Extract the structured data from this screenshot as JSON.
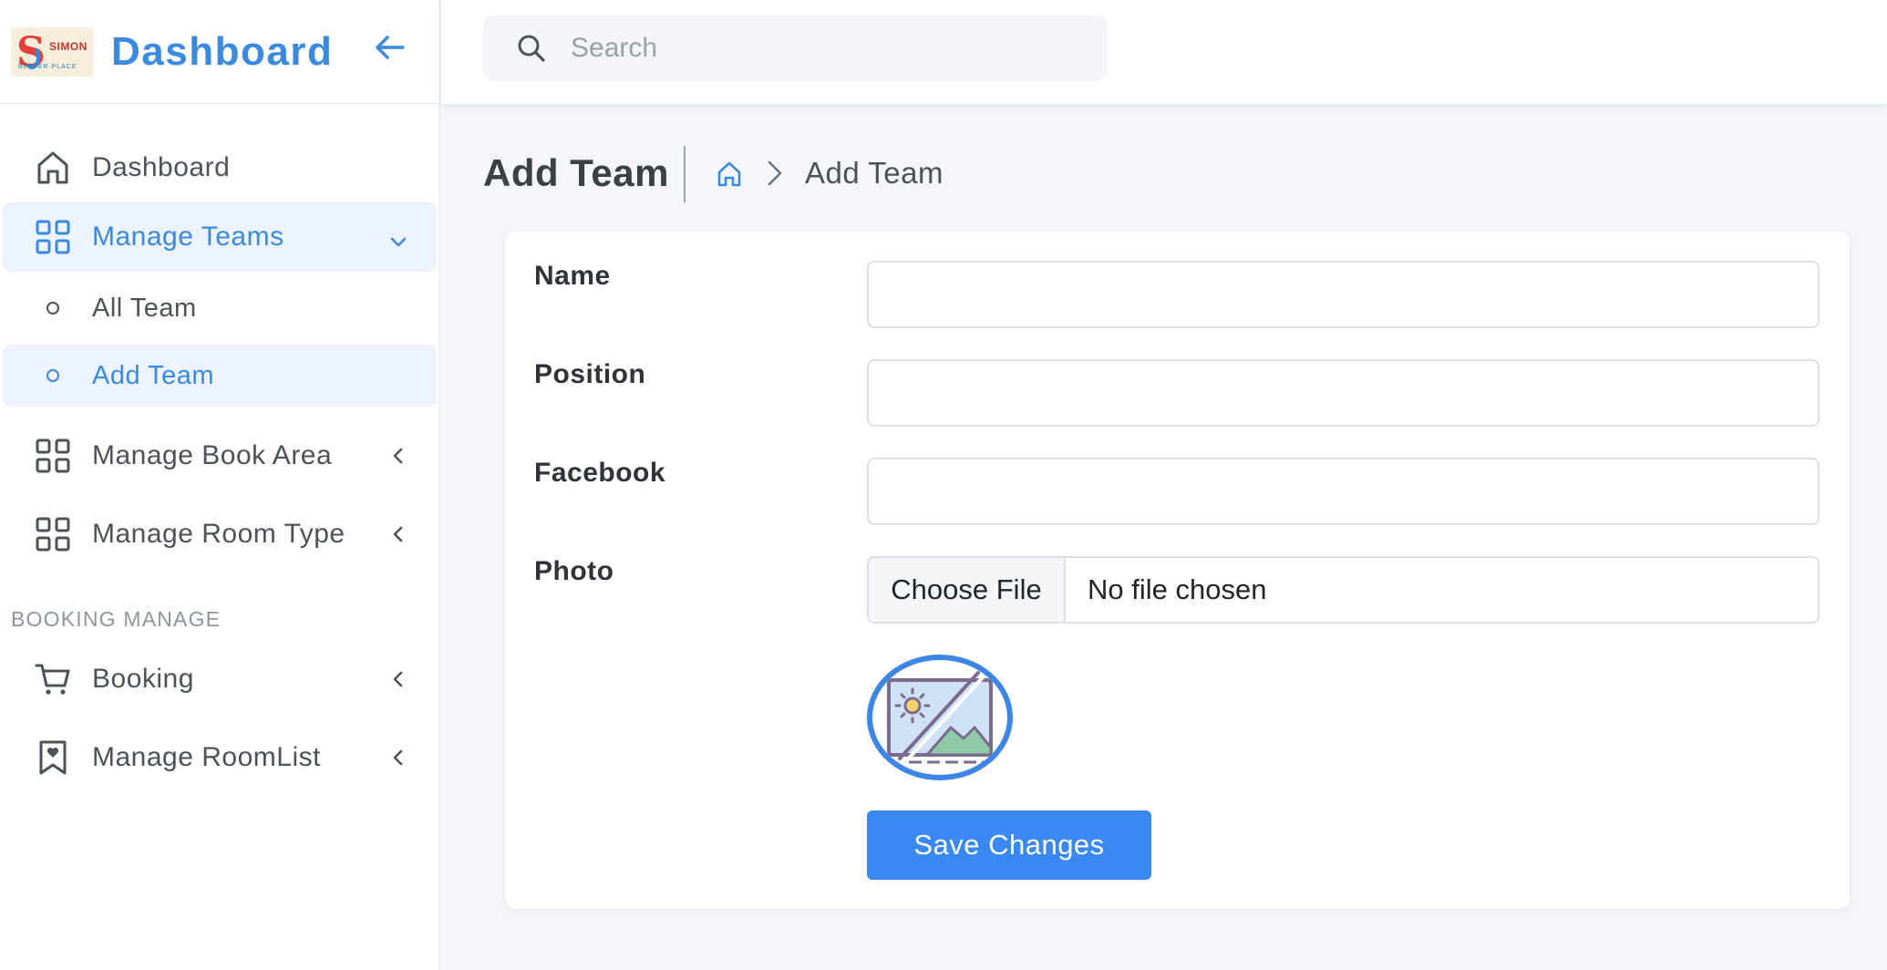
{
  "brand": {
    "logo_letter": "S",
    "logo_name": "SIMON",
    "logo_tagline": "BETTER PLACE",
    "title": "Dashboard"
  },
  "sidebar": {
    "items": [
      {
        "label": "Dashboard",
        "icon": "home-icon"
      },
      {
        "label": "Manage Teams",
        "icon": "grid-icon",
        "expanded": true,
        "children": [
          {
            "label": "All Team"
          },
          {
            "label": "Add Team",
            "active": true
          }
        ]
      },
      {
        "label": "Manage Book Area",
        "icon": "grid-icon"
      },
      {
        "label": "Manage Room Type",
        "icon": "grid-icon"
      }
    ],
    "section_label": "BOOKING MANAGE",
    "booking_items": [
      {
        "label": "Booking",
        "icon": "cart-icon"
      },
      {
        "label": "Manage RoomList",
        "icon": "bookmark-heart-icon"
      }
    ]
  },
  "search": {
    "placeholder": "Search"
  },
  "page": {
    "title": "Add Team",
    "breadcrumb_current": "Add Team"
  },
  "form": {
    "name_label": "Name",
    "name_value": "",
    "position_label": "Position",
    "position_value": "",
    "facebook_label": "Facebook",
    "facebook_value": "",
    "photo_label": "Photo",
    "choose_file_label": "Choose File",
    "file_status": "No file chosen",
    "save_label": "Save Changes"
  },
  "colors": {
    "accent": "#3a8ae0",
    "button": "#3a88f2",
    "background": "#f5f6fb",
    "active_bg": "#edf3fd"
  }
}
